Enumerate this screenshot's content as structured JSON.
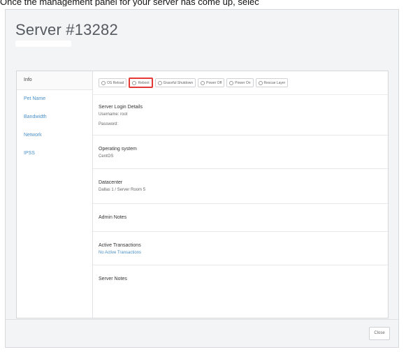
{
  "caption": "Once the management panel for your server has come up, selec",
  "modal": {
    "title": "Server #13282"
  },
  "sidebar": {
    "items": [
      {
        "label": "Info"
      },
      {
        "label": "Pet Name"
      },
      {
        "label": "Bandwidth"
      },
      {
        "label": "Network"
      },
      {
        "label": "IPSS"
      }
    ]
  },
  "actions": [
    {
      "label": "OS Reload"
    },
    {
      "label": "Reboot"
    },
    {
      "label": "Graceful Shutdown"
    },
    {
      "label": "Power Off"
    },
    {
      "label": "Power On"
    },
    {
      "label": "Rescue Layer"
    }
  ],
  "sections": {
    "login": {
      "title": "Server Login Details",
      "username": "Username: root",
      "password": "Password:"
    },
    "os": {
      "title": "Operating system",
      "value": "CentOS"
    },
    "datacenter": {
      "title": "Datacenter",
      "value": "Dallas 1 / Server Room 5"
    },
    "admin_notes": {
      "title": "Admin Notes"
    },
    "transactions": {
      "title": "Active Transactions",
      "value": "No Active Transactions"
    },
    "server_notes": {
      "title": "Server Notes"
    }
  },
  "footer": {
    "close_label": "Close"
  },
  "colors": {
    "link": "#4a90c8",
    "highlight": "#e53935",
    "modal_bg": "#f3f4f6"
  }
}
